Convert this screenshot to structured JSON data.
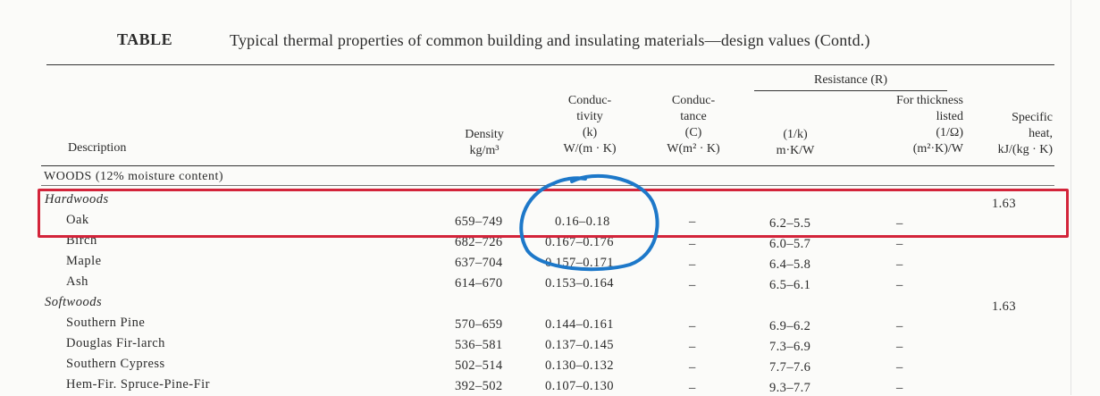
{
  "caption": {
    "label": "TABLE",
    "text": "Typical thermal properties of common building and insulating materials—design values (Contd.)"
  },
  "headers": {
    "resistance_group": "Resistance  (R)",
    "description": "Description",
    "density": [
      "Density",
      "kg/m³"
    ],
    "conductivity": [
      "Conduc-",
      "tivity",
      "(k)",
      "W/(m · K)"
    ],
    "conductance": [
      "Conduc-",
      "tance",
      "(C)",
      "W(m² · K)"
    ],
    "resistance_1k": [
      "(1/k)",
      "m·K/W"
    ],
    "resistance_thickness": [
      "For thickness",
      "listed",
      "(1/Ω)",
      "(m²·K)/W"
    ],
    "specific_heat": [
      "Specific",
      "heat,",
      "kJ/(kg · K)"
    ]
  },
  "section": "WOODS  (12%  moisture  content)",
  "groups": {
    "hardwoods": {
      "label": "Hardwoods",
      "specific_heat": "1.63"
    },
    "softwoods": {
      "label": "Softwoods",
      "specific_heat": "1.63"
    }
  },
  "rows": [
    {
      "name": "Oak",
      "density": "659–749",
      "conductivity": "0.16–0.18",
      "conductance": "–",
      "resistance": "6.2–5.5",
      "thickness": "–"
    },
    {
      "name": "Birch",
      "density": "682–726",
      "conductivity": "0.167–0.176",
      "conductance": "–",
      "resistance": "6.0–5.7",
      "thickness": "–"
    },
    {
      "name": "Maple",
      "density": "637–704",
      "conductivity": "0.157–0.171",
      "conductance": "–",
      "resistance": "6.4–5.8",
      "thickness": "–"
    },
    {
      "name": "Ash",
      "density": "614–670",
      "conductivity": "0.153–0.164",
      "conductance": "–",
      "resistance": "6.5–6.1",
      "thickness": "–"
    },
    {
      "name": "Southern  Pine",
      "density": "570–659",
      "conductivity": "0.144–0.161",
      "conductance": "–",
      "resistance": "6.9–6.2",
      "thickness": "–"
    },
    {
      "name": "Douglas  Fir-larch",
      "density": "536–581",
      "conductivity": "0.137–0.145",
      "conductance": "–",
      "resistance": "7.3–6.9",
      "thickness": "–"
    },
    {
      "name": "Southern  Cypress",
      "density": "502–514",
      "conductivity": "0.130–0.132",
      "conductance": "–",
      "resistance": "7.7–7.6",
      "thickness": "–"
    },
    {
      "name": "Hem-Fir.  Spruce-Pine-Fir",
      "density": "392–502",
      "conductivity": "0.107–0.130",
      "conductance": "–",
      "resistance": "9.3–7.7",
      "thickness": "–"
    }
  ],
  "annotation_colors": {
    "highlight_box": "#d3243a",
    "circle": "#1d78c9"
  }
}
